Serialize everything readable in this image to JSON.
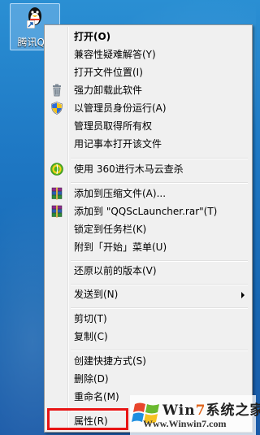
{
  "desktop": {
    "icon_label": "腾讯QQ"
  },
  "context_menu": {
    "items": [
      {
        "label": "打开(O)",
        "icon": "none"
      },
      {
        "label": "兼容性疑难解答(Y)",
        "icon": "none"
      },
      {
        "label": "打开文件位置(I)",
        "icon": "none"
      },
      {
        "label": "强力卸载此软件",
        "icon": "trash-icon"
      },
      {
        "label": "以管理员身份运行(A)",
        "icon": "uac-shield-icon"
      },
      {
        "label": "管理员取得所有权",
        "icon": "none"
      },
      {
        "label": "用记事本打开该文件",
        "icon": "none"
      },
      {
        "label": "使用 360进行木马云查杀",
        "icon": "360-icon"
      },
      {
        "label": "添加到压缩文件(A)...",
        "icon": "winrar-icon"
      },
      {
        "label": "添加到 \"QQScLauncher.rar\"(T)",
        "icon": "winrar-icon"
      },
      {
        "label": "锁定到任务栏(K)",
        "icon": "none"
      },
      {
        "label": "附到「开始」菜单(U)",
        "icon": "none"
      },
      {
        "label": "还原以前的版本(V)",
        "icon": "none"
      },
      {
        "label": "发送到(N)",
        "icon": "none"
      },
      {
        "label": "剪切(T)",
        "icon": "none"
      },
      {
        "label": "复制(C)",
        "icon": "none"
      },
      {
        "label": "创建快捷方式(S)",
        "icon": "none"
      },
      {
        "label": "删除(D)",
        "icon": "none"
      },
      {
        "label": "重命名(M)",
        "icon": "none"
      },
      {
        "label": "属性(R)",
        "icon": "none"
      }
    ]
  },
  "watermark": {
    "brand_prefix": "Win",
    "brand_num": "7",
    "brand_suffix": "系统之家",
    "url": "Www.Winwin7.com"
  },
  "colors": {
    "highlight_border": "#e81515",
    "menu_bg": "#f0f0f0"
  }
}
